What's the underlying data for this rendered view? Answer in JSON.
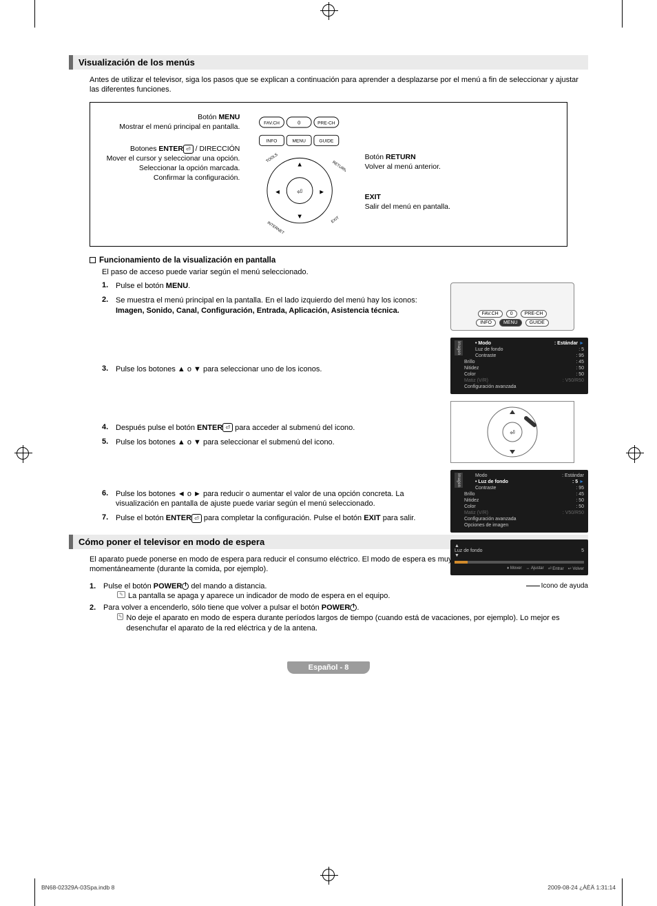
{
  "section1": {
    "title": "Visualización de los menús",
    "intro": "Antes de utilizar el televisor, siga los pasos que se explican a continuación para aprender a desplazarse por el menú a fin de seleccionar y ajustar las diferentes funciones.",
    "left": {
      "menu_btn_label": "Botón MENU",
      "menu_btn_desc": "Mostrar el menú principal en pantalla.",
      "enter_btn_label": "Botones ENTER",
      "enter_btn_suffix": " / DIRECCIÓN",
      "enter_desc1": "Mover el cursor y seleccionar una opción.",
      "enter_desc2": "Seleccionar la opción marcada.",
      "enter_desc3": "Confirmar la configuración."
    },
    "right": {
      "return_btn_label": "Botón RETURN",
      "return_desc": "Volver al menú anterior.",
      "exit_label": "EXIT",
      "exit_desc": "Salir del menú en pantalla."
    },
    "remote_keys": {
      "favch": "FAV.CH",
      "zero": "0",
      "prech": "PRE-CH",
      "info": "INFO",
      "menu": "MENU",
      "guide": "GUIDE",
      "tools": "TOOLS",
      "return": "RETURN",
      "internet": "INTERNET",
      "exit": "EXIT"
    },
    "sub": {
      "heading": "Funcionamiento de la visualización en pantalla",
      "note": "El paso de acceso puede variar según el menú seleccionado.",
      "steps": [
        {
          "n": "1.",
          "t": "Pulse el botón MENU."
        },
        {
          "n": "2.",
          "t": "Se muestra el menú principal en la pantalla. En el lado izquierdo del menú hay los iconos: ",
          "bold": "Imagen, Sonido, Canal, Configuración, Entrada, Aplicación, Asistencia técnica."
        },
        {
          "n": "3.",
          "t": "Pulse los botones ▲ o ▼ para seleccionar uno de los iconos."
        },
        {
          "n": "4.",
          "t": "Después pulse el botón ENTER",
          "suffix": " para acceder al submenú del icono."
        },
        {
          "n": "5.",
          "t": "Pulse los botones ▲ o ▼ para seleccionar el submenú del icono."
        },
        {
          "n": "6.",
          "t": "Pulse los botones ◄ o ► para reducir o aumentar el valor de una opción concreta. La visualización en pantalla de ajuste puede variar según el menú seleccionado."
        },
        {
          "n": "7.",
          "t": "Pulse el botón ENTER",
          "suffix": " para completar la configuración. Pulse el botón EXIT para salir."
        }
      ]
    },
    "osd1": {
      "tab": "Imagen",
      "rows": [
        {
          "k": "Modo",
          "v": ": Estándar",
          "sel": true,
          "arrow": "►"
        },
        {
          "k": "Luz de fondo",
          "v": ": 5"
        },
        {
          "k": "Contraste",
          "v": ": 95"
        },
        {
          "k": "Brillo",
          "v": ": 45"
        },
        {
          "k": "Nitidez",
          "v": ": 50"
        },
        {
          "k": "Color",
          "v": ": 50"
        },
        {
          "k": "Matiz (V/R)",
          "v": ": V50/R50",
          "dim": true
        },
        {
          "k": "Configuración avanzada",
          "v": ""
        }
      ]
    },
    "osd2": {
      "tab": "Imagen",
      "rows": [
        {
          "k": "Modo",
          "v": ": Estándar"
        },
        {
          "k": "Luz de fondo",
          "v": ": 5",
          "sel": true,
          "arrow": "►"
        },
        {
          "k": "Contraste",
          "v": ": 95"
        },
        {
          "k": "Brillo",
          "v": ": 45"
        },
        {
          "k": "Nitidez",
          "v": ": 50"
        },
        {
          "k": "Color",
          "v": ": 50"
        },
        {
          "k": "Matiz (V/R)",
          "v": ": V50/R50",
          "dim": true
        },
        {
          "k": "Configuración avanzada",
          "v": ""
        },
        {
          "k": "Opciones de imagen",
          "v": ""
        }
      ]
    },
    "slider": {
      "label": "Luz de fondo",
      "value": "5",
      "foot": [
        "♦ Mover",
        "↔ Ajustar",
        "⏎ Entrar",
        "↩ Volver"
      ]
    },
    "help_label": "Icono de ayuda"
  },
  "section2": {
    "title": "Cómo poner el televisor en modo de espera",
    "intro": "El aparato puede ponerse en modo de espera para reducir el consumo eléctrico. El modo de espera es muy útil si desea interrumpir la visualización momentáneamente (durante la comida, por ejemplo).",
    "steps": [
      {
        "n": "1.",
        "t": "Pulse el botón POWER",
        "suffix": " del mando a distancia.",
        "note": "La pantalla se apaga y aparece un indicador de modo de espera en el equipo."
      },
      {
        "n": "2.",
        "t": "Para volver a encenderlo, sólo tiene que volver a pulsar el botón POWER",
        "suffix": ".",
        "note": "No deje el aparato en modo de espera durante períodos largos de tiempo (cuando está de vacaciones, por ejemplo). Lo mejor es desenchufar el aparato de la red eléctrica y de la antena."
      }
    ]
  },
  "pagenum": "Español - 8",
  "footer": {
    "left": "BN68-02329A-03Spa.indb   8",
    "right": "2009-08-24   ¿ÀÈÄ 1:31:14"
  }
}
